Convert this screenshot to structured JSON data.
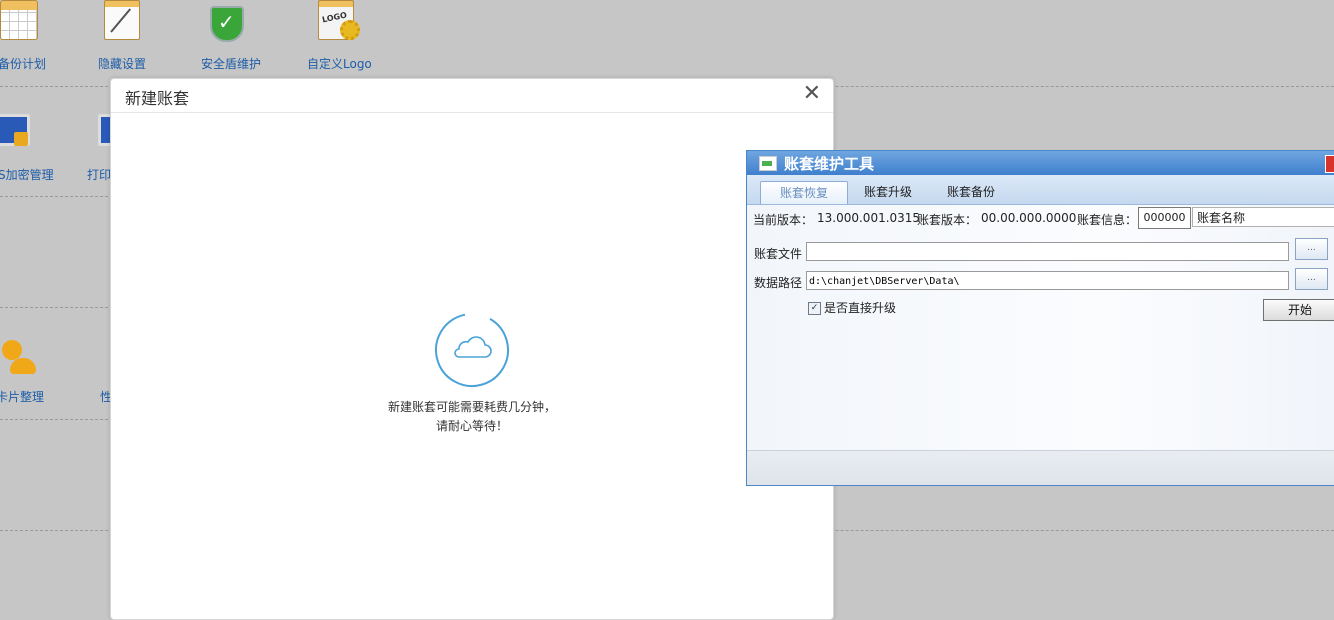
{
  "desktop": {
    "tiles_row1": [
      "备份计划",
      "隐藏设置",
      "安全盾维护",
      "自定义Logo"
    ],
    "tiles_row2": [
      "S加密管理",
      "打印"
    ],
    "tiles_row3": [
      "卡片整理",
      "性"
    ],
    "logo_text": "LOGO"
  },
  "dialog": {
    "title": "新建账套",
    "close_glyph": "✕",
    "wait_line1": "新建账套可能需要耗费几分钟，",
    "wait_line2": "请耐心等待！"
  },
  "tool": {
    "title": "账套维护工具",
    "tabs": [
      "账套恢复",
      "账套升级",
      "账套备份"
    ],
    "active_tab": "账套恢复",
    "current_version_label": "当前版本：",
    "current_version": "13.000.001.0315",
    "account_version_label": "账套版本：",
    "account_version": "00.00.000.0000",
    "account_info_label": "账套信息：",
    "account_code": "000000",
    "account_name": "账套名称",
    "file_label": "账套文件",
    "file_value": "",
    "path_label": "数据路径",
    "path_value": "d:\\chanjet\\DBServer\\Data\\",
    "browse_label": "...",
    "direct_upgrade_label": "是否直接升级",
    "direct_upgrade_checked": true,
    "start_label": "开始"
  },
  "colors": {
    "link": "#1d5da8",
    "tool_title": "#3f7fcd",
    "loader_ring": "#4aa3d8"
  }
}
